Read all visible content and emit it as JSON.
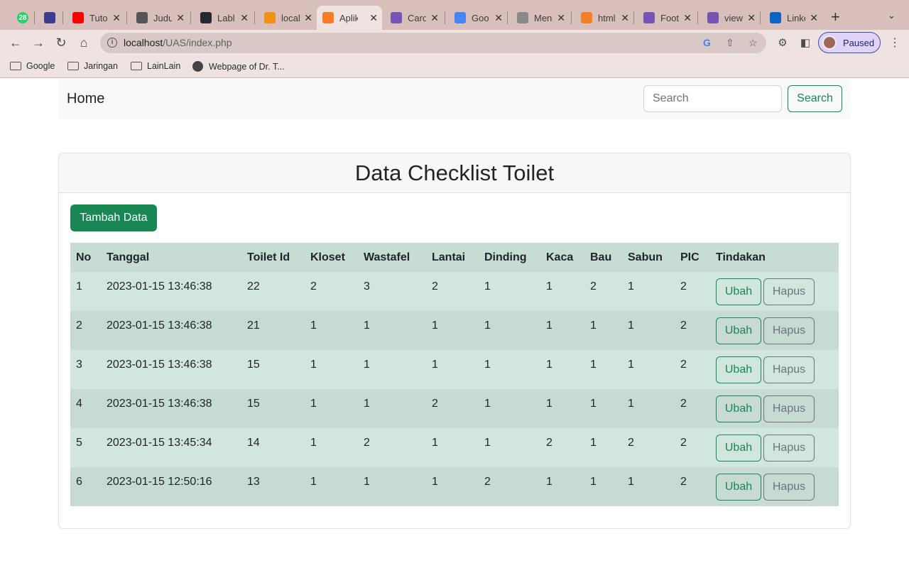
{
  "browser": {
    "tabs": [
      {
        "label": "28",
        "icon": "whatsapp-icon",
        "color": "#25d366"
      },
      {
        "label": "",
        "icon": "hat-icon",
        "color": "#3b3b8f"
      },
      {
        "label": "Tuto",
        "icon": "youtube-icon",
        "color": "#ff0000"
      },
      {
        "label": "Judu",
        "icon": "globe-icon",
        "color": "#555555"
      },
      {
        "label": "Labl",
        "icon": "github-icon",
        "color": "#24292f"
      },
      {
        "label": "local",
        "icon": "phpmyadmin-icon",
        "color": "#f29111"
      },
      {
        "label": "Aplik",
        "icon": "xampp-icon",
        "color": "#fb7a24"
      },
      {
        "label": "Card",
        "icon": "bootstrap-icon",
        "color": "#7952b3"
      },
      {
        "label": "Goo",
        "icon": "translate-icon",
        "color": "#4285f4"
      },
      {
        "label": "Men",
        "icon": "document-icon",
        "color": "#888888"
      },
      {
        "label": "html",
        "icon": "stackoverflow-icon",
        "color": "#f48024"
      },
      {
        "label": "Foot",
        "icon": "bootstrap-icon",
        "color": "#7952b3"
      },
      {
        "label": "view",
        "icon": "bootstrap-icon",
        "color": "#7952b3"
      },
      {
        "label": "Linke",
        "icon": "linkedin-icon",
        "color": "#0a66c2"
      }
    ],
    "url_host": "localhost",
    "url_path": "/UAS/index.php",
    "profile_label": "Paused",
    "bookmarks": [
      "Google",
      "Jaringan",
      "LainLain",
      "Webpage of Dr. T..."
    ]
  },
  "navbar": {
    "brand": "Home",
    "search_placeholder": "Search",
    "search_button": "Search"
  },
  "card": {
    "title": "Data Checklist Toilet",
    "add_button": "Tambah Data"
  },
  "table": {
    "headers": [
      "No",
      "Tanggal",
      "Toilet Id",
      "Kloset",
      "Wastafel",
      "Lantai",
      "Dinding",
      "Kaca",
      "Bau",
      "Sabun",
      "PIC",
      "Tindakan"
    ],
    "rows": [
      [
        "1",
        "2023-01-15 13:46:38",
        "22",
        "2",
        "3",
        "2",
        "1",
        "1",
        "2",
        "1",
        "2"
      ],
      [
        "2",
        "2023-01-15 13:46:38",
        "21",
        "1",
        "1",
        "1",
        "1",
        "1",
        "1",
        "1",
        "2"
      ],
      [
        "3",
        "2023-01-15 13:46:38",
        "15",
        "1",
        "1",
        "1",
        "1",
        "1",
        "1",
        "1",
        "2"
      ],
      [
        "4",
        "2023-01-15 13:46:38",
        "15",
        "1",
        "1",
        "2",
        "1",
        "1",
        "1",
        "1",
        "2"
      ],
      [
        "5",
        "2023-01-15 13:45:34",
        "14",
        "1",
        "2",
        "1",
        "1",
        "2",
        "1",
        "2",
        "2"
      ],
      [
        "6",
        "2023-01-15 12:50:16",
        "13",
        "1",
        "1",
        "1",
        "2",
        "1",
        "1",
        "1",
        "2"
      ]
    ],
    "edit_label": "Ubah",
    "delete_label": "Hapus"
  },
  "colors": {
    "success": "#198754",
    "secondary": "#6c757d",
    "row_odd": "#d1e7dd",
    "row_even": "#c7dbd2"
  }
}
